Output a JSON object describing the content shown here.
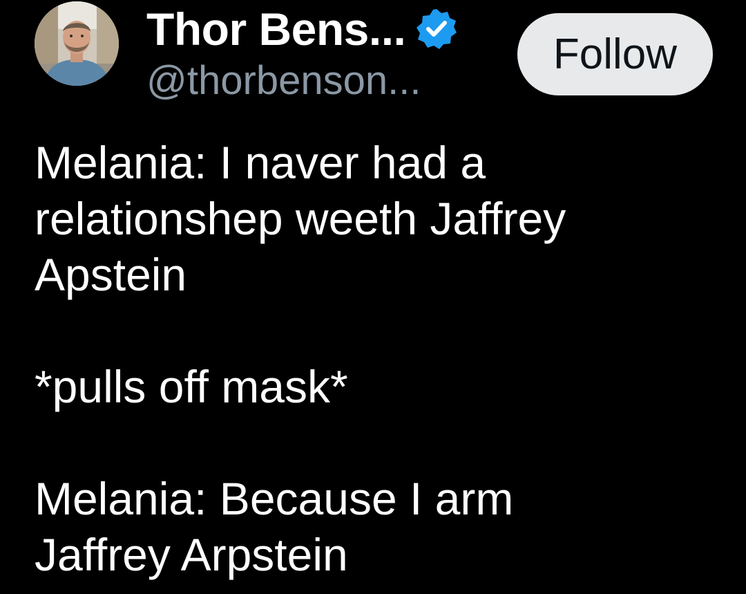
{
  "author": {
    "display_name": "Thor Bens...",
    "handle": "@thorbenson...",
    "verified": true,
    "avatar_icon": "person-avatar-photo",
    "verified_icon": "verified-badge-icon",
    "verified_color": "#1d9bf0"
  },
  "actions": {
    "follow_label": "Follow"
  },
  "tweet": {
    "text": "Melania: I naver had a\nrelationshep weeth Jaffrey\nApstein\n\n*pulls off mask*\n\nMelania: Because I arm\nJaffrey Arpstein"
  },
  "colors": {
    "background": "#000000",
    "text": "#ffffff",
    "secondary_text": "#8b98a5",
    "follow_button_bg": "#e7e9ea",
    "follow_button_text": "#0f1419"
  }
}
